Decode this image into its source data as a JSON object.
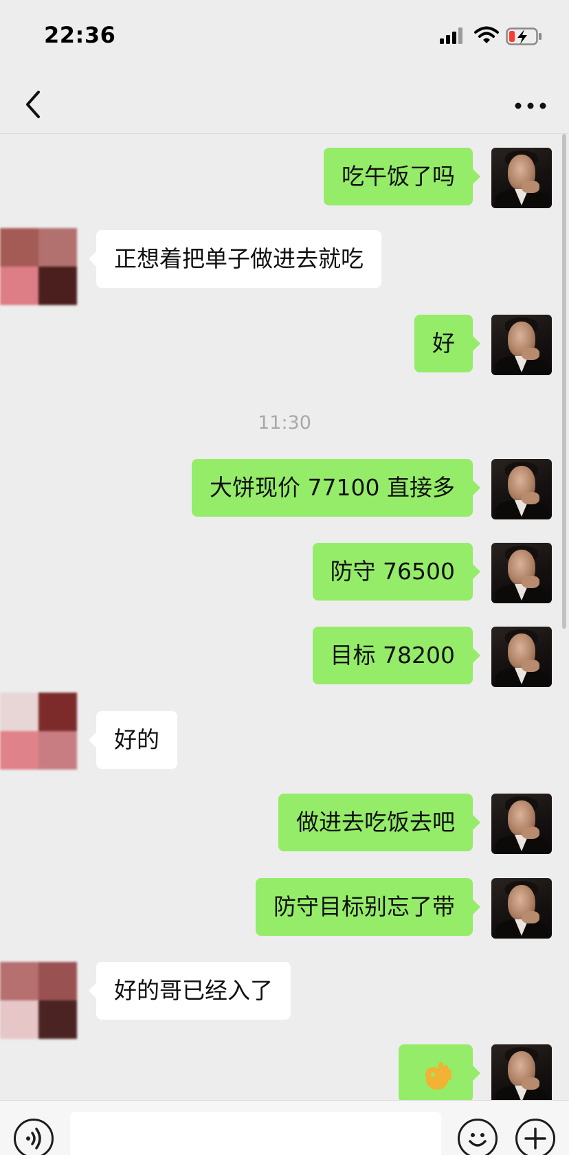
{
  "status_bar": {
    "time": "22:36",
    "icons": [
      "signal-icon",
      "wifi-icon",
      "battery-charging-icon"
    ]
  },
  "nav": {
    "title": "",
    "back_icon": "chevron-left-icon",
    "more_icon": "more-dots-icon"
  },
  "messages": [
    {
      "sender": "me",
      "text": "吃午饭了吗"
    },
    {
      "sender": "other",
      "text": "正想着把单子做进去就吃"
    },
    {
      "sender": "me",
      "text": "好"
    },
    {
      "type": "time",
      "text": "11:30"
    },
    {
      "sender": "me",
      "text": "大饼现价 77100 直接多"
    },
    {
      "sender": "me",
      "text": "防守 76500"
    },
    {
      "sender": "me",
      "text": "目标 78200"
    },
    {
      "sender": "other",
      "text": "好的"
    },
    {
      "sender": "me",
      "text": "做进去吃饭去吧"
    },
    {
      "sender": "me",
      "text": "防守目标别忘了带"
    },
    {
      "sender": "other",
      "text": "好的哥已经入了"
    },
    {
      "sender": "me",
      "text": "",
      "icon": "ok-hand-emoji-icon"
    }
  ],
  "input_bar": {
    "placeholder": "",
    "voice_icon": "voice-icon",
    "emoji_icon": "emoji-icon",
    "plus_icon": "plus-icon"
  },
  "colors": {
    "background": "#ededed",
    "my_bubble": "#95ec69",
    "other_bubble": "#ffffff",
    "timestamp_text": "#a8a8a8"
  }
}
